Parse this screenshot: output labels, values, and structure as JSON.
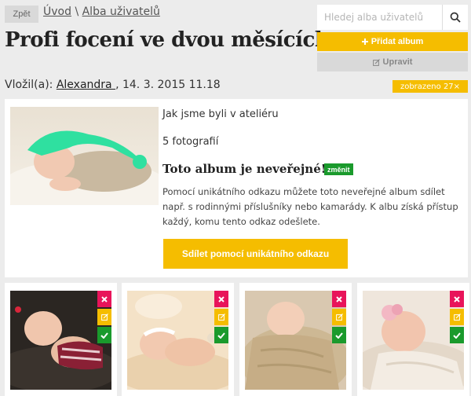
{
  "nav": {
    "back_label": "Zpět",
    "breadcrumb_home": "Úvod",
    "breadcrumb_sep": "\\",
    "breadcrumb_albums": "Alba uživatelů"
  },
  "title": "Profi focení ve dvou měsících",
  "search": {
    "placeholder": "Hledej alba uživatelů"
  },
  "actions": {
    "add_album": "Přidat album",
    "edit": "Upravit"
  },
  "meta": {
    "author_prefix": "Vložil(a):",
    "author": "Alexandra ",
    "date": ", 14. 3. 2015 11.18",
    "views": "zobrazeno 27×"
  },
  "album": {
    "name": "Jak jsme byli v ateliéru",
    "photo_count": "5 fotografií",
    "private_notice": "Toto album je neveřejné!",
    "change_label": "změnit",
    "description": "Pomocí unikátního odkazu můžete toto neveřejné album sdílet např. s rodinnými příslušníky nebo kamarády. K albu získá přístup každý, komu tento odkaz odešlete.",
    "share_label": "Sdílet pomocí unikátního odkazu"
  },
  "colors": {
    "accent": "#f5bd00",
    "delete": "#e8145a",
    "confirm": "#1a9a2c",
    "background": "#ececec"
  }
}
